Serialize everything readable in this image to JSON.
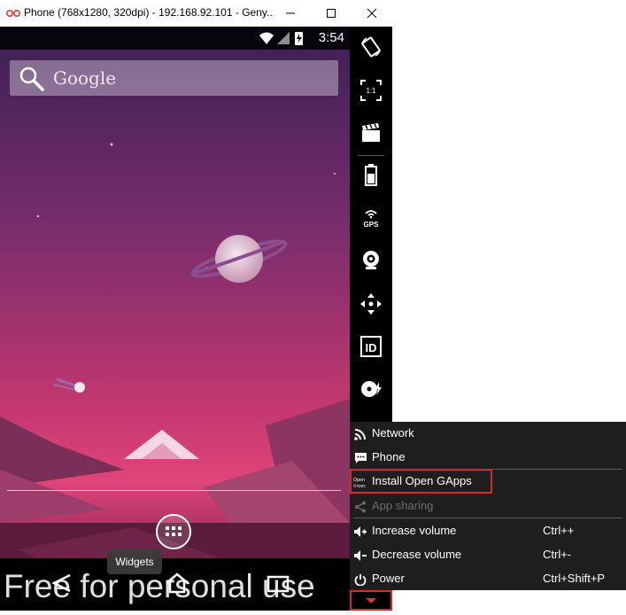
{
  "window": {
    "title": "Phone (768x1280, 320dpi) - 192.168.92.101 - Geny..."
  },
  "status_bar": {
    "time": "3:54"
  },
  "home_screen": {
    "search_placeholder": "Google",
    "widgets_tooltip": "Widgets",
    "watermark": "Free for personal use"
  },
  "toolbar": {
    "icons": [
      "rotate-icon",
      "pixel-perfect-icon",
      "screencast-icon",
      "battery-icon",
      "gps-icon",
      "camera-icon",
      "remote-control-icon",
      "identifiers-icon",
      "disk-io-icon"
    ],
    "gps_label": "GPS",
    "pixel_label": "1:1",
    "id_label": "ID"
  },
  "menu": {
    "items": [
      {
        "label": "Network",
        "shortcut": "",
        "icon": "wifi-icon",
        "enabled": true
      },
      {
        "label": "Phone",
        "shortcut": "",
        "icon": "phone-sms-icon",
        "enabled": true
      },
      {
        "label": "Install Open GApps",
        "shortcut": "",
        "icon": "open-gapps-icon",
        "enabled": true
      },
      {
        "label": "App sharing",
        "shortcut": "",
        "icon": "share-icon",
        "enabled": false
      },
      {
        "label": "Increase volume",
        "shortcut": "Ctrl++",
        "icon": "volume-up-icon",
        "enabled": true
      },
      {
        "label": "Decrease volume",
        "shortcut": "Ctrl+-",
        "icon": "volume-down-icon",
        "enabled": true
      },
      {
        "label": "Power",
        "shortcut": "Ctrl+Shift+P",
        "icon": "power-icon",
        "enabled": true
      }
    ],
    "open_gapps_icon_text": "Open GApps"
  },
  "colors": {
    "highlight": "#d9262b",
    "toolbar_bg": "#000000",
    "menu_bg": "#1e1e1e"
  }
}
